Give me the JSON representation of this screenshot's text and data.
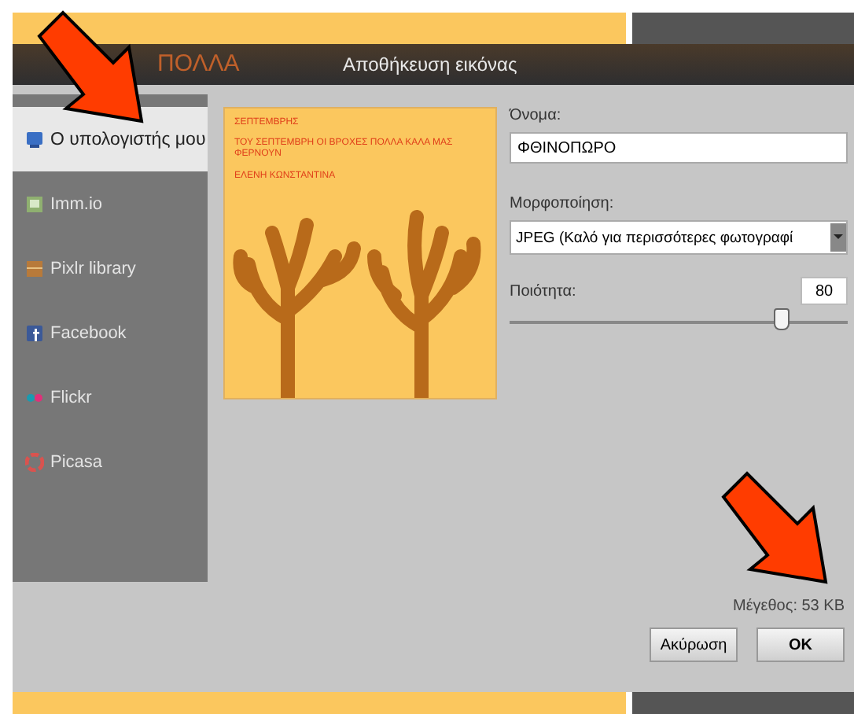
{
  "window": {
    "title": "Αποθήκευση εικόνας"
  },
  "background_text": "ΠΟΛΛΑ",
  "sidebar": {
    "items": [
      {
        "label": "Ο υπολογιστής μου",
        "selected": true,
        "kind": "computer"
      },
      {
        "label": "Imm.io",
        "selected": false,
        "kind": "immio"
      },
      {
        "label": "Pixlr library",
        "selected": false,
        "kind": "library"
      },
      {
        "label": "Facebook",
        "selected": false,
        "kind": "facebook"
      },
      {
        "label": "Flickr",
        "selected": false,
        "kind": "flickr"
      },
      {
        "label": "Picasa",
        "selected": false,
        "kind": "picasa"
      }
    ]
  },
  "preview": {
    "lines": [
      "ΣΕΠΤΕΜΒΡΗΣ",
      "ΤΟΥ ΣΕΠΤΕΜΒΡΗ ΟΙ ΒΡΟΧΕΣ ΠΟΛΛΑ ΚΑΛΑ ΜΑΣ ΦΕΡΝΟΥΝ",
      "ΕΛΕΝΗ ΚΩΝΣΤΑΝΤΙΝΑ"
    ]
  },
  "form": {
    "name": {
      "label": "Όνομα:",
      "value": "ΦΘΙΝΟΠΩΡΟ"
    },
    "format": {
      "label": "Μορφοποίηση:",
      "value": "JPEG (Καλό για περισσότερες φωτογραφί"
    },
    "quality": {
      "label": "Ποιότητα:",
      "value": "80",
      "level": 0.8
    }
  },
  "size": "Μέγεθος: 53 KB",
  "buttons": [
    {
      "label": "Ακύρωση",
      "kind": "cancel"
    },
    {
      "label": "OK",
      "kind": "ok"
    }
  ]
}
